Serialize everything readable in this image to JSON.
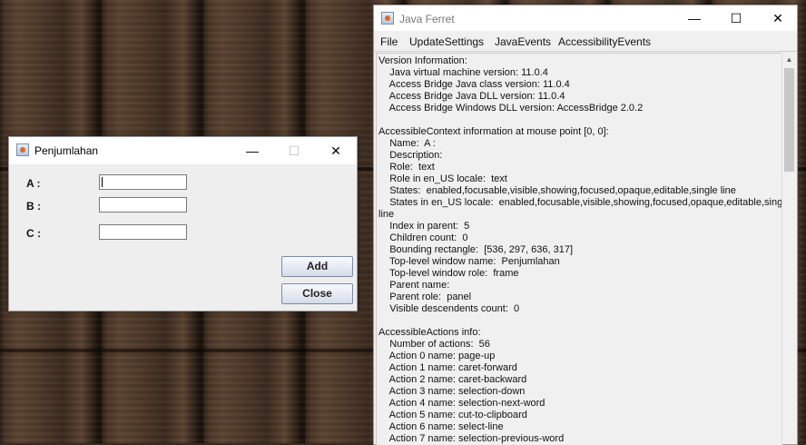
{
  "penjumlahan_window": {
    "title": "Penjumlahan",
    "controls": {
      "minimize": "—",
      "maximize": "☐",
      "close": "✕"
    },
    "fields": [
      {
        "label": "A :",
        "value": ""
      },
      {
        "label": "B :",
        "value": ""
      },
      {
        "label": "C :",
        "value": ""
      }
    ],
    "buttons": {
      "add": "Add",
      "close": "Close"
    }
  },
  "ferret_window": {
    "title": "Java Ferret",
    "controls": {
      "minimize": "—",
      "maximize": "☐",
      "close": "✕"
    },
    "menu": [
      "File",
      "UpdateSettings",
      "JavaEvents",
      "AccessibilityEvents"
    ],
    "scroll_up_glyph": "▲",
    "lines": [
      "Version Information:",
      "    Java virtual machine version: 11.0.4",
      "    Access Bridge Java class version: 11.0.4",
      "    Access Bridge Java DLL version: 11.0.4",
      "    Access Bridge Windows DLL version: AccessBridge 2.0.2",
      "",
      "AccessibleContext information at mouse point [0, 0]:",
      "    Name:  A :",
      "    Description:",
      "    Role:  text",
      "    Role in en_US locale:  text",
      "    States:  enabled,focusable,visible,showing,focused,opaque,editable,single line",
      "    States in en_US locale:  enabled,focusable,visible,showing,focused,opaque,editable,single",
      "line",
      "    Index in parent:  5",
      "    Children count:  0",
      "    Bounding rectangle:  [536, 297, 636, 317]",
      "    Top-level window name:  Penjumlahan",
      "    Top-level window role:  frame",
      "    Parent name:",
      "    Parent role:  panel",
      "    Visible descendents count:  0",
      "",
      "AccessibleActions info:",
      "    Number of actions:  56",
      "    Action 0 name: page-up",
      "    Action 1 name: caret-forward",
      "    Action 2 name: caret-backward",
      "    Action 3 name: selection-down",
      "    Action 4 name: selection-next-word",
      "    Action 5 name: cut-to-clipboard",
      "    Action 6 name: select-line",
      "    Action 7 name: selection-previous-word"
    ]
  }
}
